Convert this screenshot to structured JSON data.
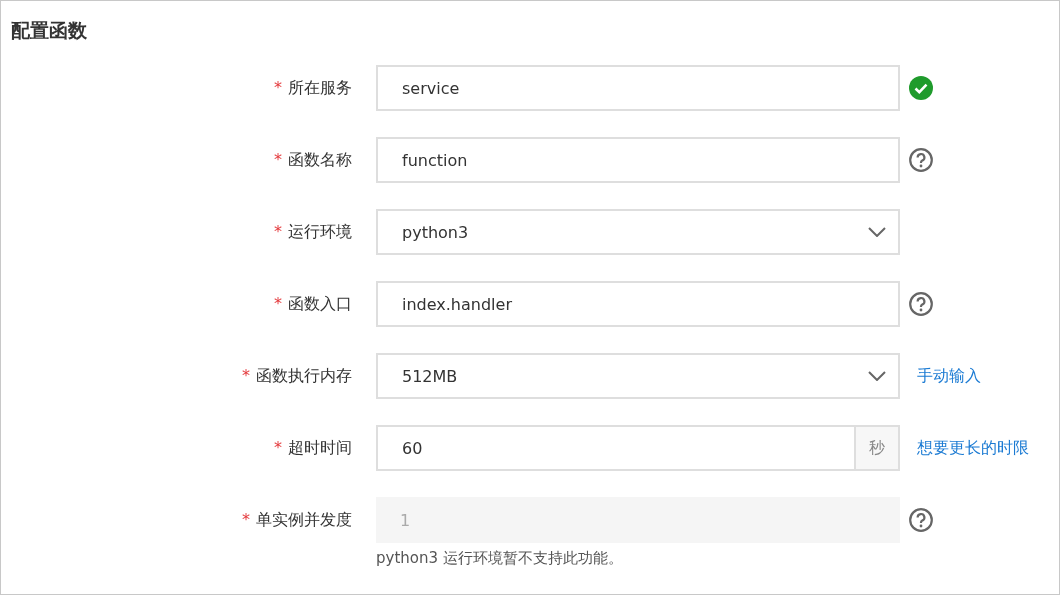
{
  "section": {
    "title": "配置函数"
  },
  "fields": [
    {
      "mark": "*",
      "label": "所在服务",
      "kind": "input",
      "value": "service",
      "trailing": {
        "kind": "valid"
      }
    },
    {
      "mark": "*",
      "label": "函数名称",
      "kind": "input",
      "value": "function",
      "trailing": {
        "kind": "help"
      }
    },
    {
      "mark": "*",
      "label": "运行环境",
      "kind": "select",
      "value": "python3"
    },
    {
      "mark": "*",
      "label": "函数入口",
      "kind": "input",
      "value": "index.handler",
      "trailing": {
        "kind": "help"
      }
    },
    {
      "mark": "*",
      "label": "函数执行内存",
      "kind": "select",
      "value": "512MB",
      "trailing": {
        "kind": "link",
        "text": "手动输入"
      }
    },
    {
      "mark": "*",
      "label": "超时时间",
      "kind": "suffix",
      "value": "60",
      "suffix": "秒",
      "trailing": {
        "kind": "link",
        "text": "想要更长的时限"
      }
    },
    {
      "mark": "*",
      "label": "单实例并发度",
      "kind": "input",
      "value": "1",
      "disabled": true,
      "trailing": {
        "kind": "help"
      },
      "hint": "python3 运行环境暂不支持此功能。"
    }
  ]
}
